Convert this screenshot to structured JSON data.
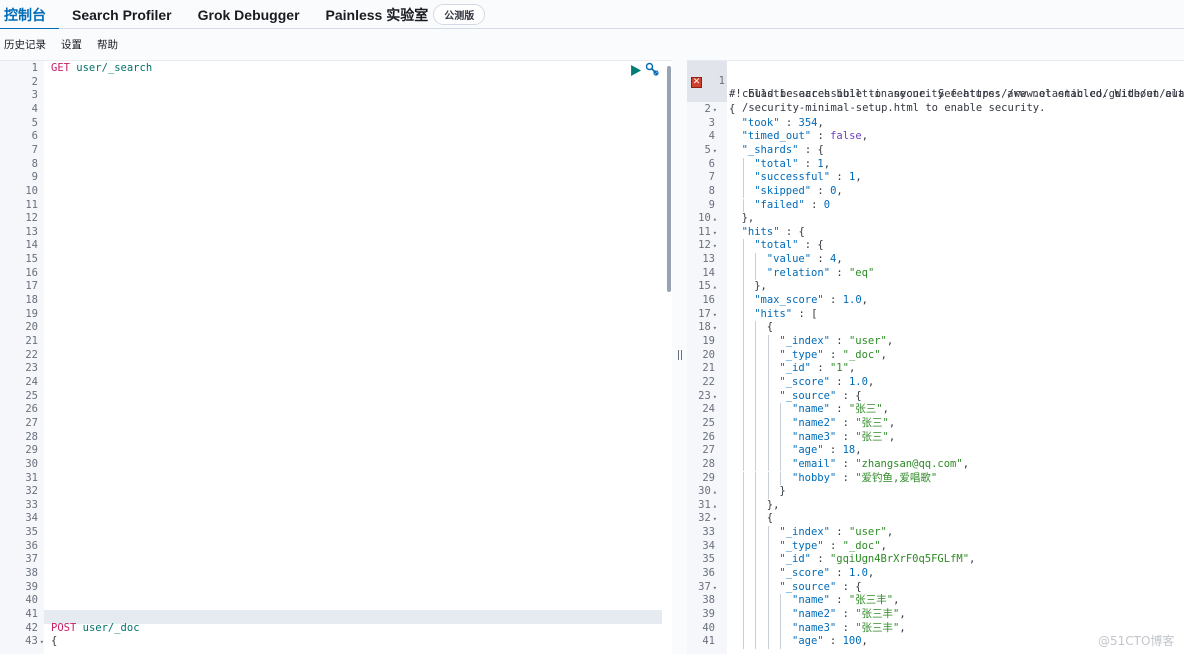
{
  "nav": {
    "tabs": [
      {
        "label": "控制台",
        "active": true
      },
      {
        "label": "Search Profiler",
        "active": false
      },
      {
        "label": "Grok Debugger",
        "active": false
      },
      {
        "label": "Painless 实验室",
        "active": false
      }
    ],
    "beta_badge": "公测版"
  },
  "toolbar": {
    "history": "历史记录",
    "settings": "设置",
    "help": "帮助"
  },
  "request_editor": {
    "line_numbers": [
      "1",
      "2",
      "3",
      "4",
      "5",
      "6",
      "7",
      "8",
      "9",
      "10",
      "11",
      "12",
      "13",
      "14",
      "15",
      "16",
      "17",
      "18",
      "19",
      "20",
      "21",
      "22",
      "23",
      "24",
      "25",
      "26",
      "27",
      "28",
      "29",
      "30",
      "31",
      "32",
      "33",
      "34",
      "35",
      "36",
      "37",
      "38",
      "39",
      "40",
      "41",
      "42",
      "43"
    ],
    "request1": {
      "method": "GET",
      "path": "user/_search"
    },
    "request2": {
      "method": "POST",
      "path": "user/_doc"
    },
    "line43": "{",
    "icons": {
      "run": "play-icon",
      "settings": "wrench-icon"
    }
  },
  "response_editor": {
    "warning": "#! Elasticsearch built-in security features are not enabled. Without auth",
    "warning_cont1": "could be accessible to anyone. See https://www.elastic.co/guide/en/elas",
    "warning_cont2": "/security-minimal-setup.html to enable security.",
    "lines": [
      {
        "n": "2",
        "fold": "▾",
        "indent": 0,
        "parts": [
          [
            "p",
            "{"
          ]
        ]
      },
      {
        "n": "3",
        "indent": 1,
        "parts": [
          [
            "k",
            "\"took\""
          ],
          [
            "p",
            " : "
          ],
          [
            "n",
            "354"
          ],
          [
            "p",
            ","
          ]
        ]
      },
      {
        "n": "4",
        "indent": 1,
        "parts": [
          [
            "k",
            "\"timed_out\""
          ],
          [
            "p",
            " : "
          ],
          [
            "b",
            "false"
          ],
          [
            "p",
            ","
          ]
        ]
      },
      {
        "n": "5",
        "fold": "▾",
        "indent": 1,
        "parts": [
          [
            "k",
            "\"_shards\""
          ],
          [
            "p",
            " : {"
          ]
        ]
      },
      {
        "n": "6",
        "indent": 2,
        "parts": [
          [
            "k",
            "\"total\""
          ],
          [
            "p",
            " : "
          ],
          [
            "n",
            "1"
          ],
          [
            "p",
            ","
          ]
        ]
      },
      {
        "n": "7",
        "indent": 2,
        "parts": [
          [
            "k",
            "\"successful\""
          ],
          [
            "p",
            " : "
          ],
          [
            "n",
            "1"
          ],
          [
            "p",
            ","
          ]
        ]
      },
      {
        "n": "8",
        "indent": 2,
        "parts": [
          [
            "k",
            "\"skipped\""
          ],
          [
            "p",
            " : "
          ],
          [
            "n",
            "0"
          ],
          [
            "p",
            ","
          ]
        ]
      },
      {
        "n": "9",
        "indent": 2,
        "parts": [
          [
            "k",
            "\"failed\""
          ],
          [
            "p",
            " : "
          ],
          [
            "n",
            "0"
          ]
        ]
      },
      {
        "n": "10",
        "fold": "▴",
        "indent": 1,
        "parts": [
          [
            "p",
            "},"
          ]
        ]
      },
      {
        "n": "11",
        "fold": "▾",
        "indent": 1,
        "parts": [
          [
            "k",
            "\"hits\""
          ],
          [
            "p",
            " : {"
          ]
        ]
      },
      {
        "n": "12",
        "fold": "▾",
        "indent": 2,
        "parts": [
          [
            "k",
            "\"total\""
          ],
          [
            "p",
            " : {"
          ]
        ]
      },
      {
        "n": "13",
        "indent": 3,
        "parts": [
          [
            "k",
            "\"value\""
          ],
          [
            "p",
            " : "
          ],
          [
            "n",
            "4"
          ],
          [
            "p",
            ","
          ]
        ]
      },
      {
        "n": "14",
        "indent": 3,
        "parts": [
          [
            "k",
            "\"relation\""
          ],
          [
            "p",
            " : "
          ],
          [
            "s",
            "\"eq\""
          ]
        ]
      },
      {
        "n": "15",
        "fold": "▴",
        "indent": 2,
        "parts": [
          [
            "p",
            "},"
          ]
        ]
      },
      {
        "n": "16",
        "indent": 2,
        "parts": [
          [
            "k",
            "\"max_score\""
          ],
          [
            "p",
            " : "
          ],
          [
            "n",
            "1.0"
          ],
          [
            "p",
            ","
          ]
        ]
      },
      {
        "n": "17",
        "fold": "▾",
        "indent": 2,
        "parts": [
          [
            "k",
            "\"hits\""
          ],
          [
            "p",
            " : ["
          ]
        ]
      },
      {
        "n": "18",
        "fold": "▾",
        "indent": 3,
        "parts": [
          [
            "p",
            "{"
          ]
        ]
      },
      {
        "n": "19",
        "indent": 4,
        "parts": [
          [
            "k",
            "\"_index\""
          ],
          [
            "p",
            " : "
          ],
          [
            "s",
            "\"user\""
          ],
          [
            "p",
            ","
          ]
        ]
      },
      {
        "n": "20",
        "indent": 4,
        "parts": [
          [
            "k",
            "\"_type\""
          ],
          [
            "p",
            " : "
          ],
          [
            "s",
            "\"_doc\""
          ],
          [
            "p",
            ","
          ]
        ]
      },
      {
        "n": "21",
        "indent": 4,
        "parts": [
          [
            "k",
            "\"_id\""
          ],
          [
            "p",
            " : "
          ],
          [
            "s",
            "\"1\""
          ],
          [
            "p",
            ","
          ]
        ]
      },
      {
        "n": "22",
        "indent": 4,
        "parts": [
          [
            "k",
            "\"_score\""
          ],
          [
            "p",
            " : "
          ],
          [
            "n",
            "1.0"
          ],
          [
            "p",
            ","
          ]
        ]
      },
      {
        "n": "23",
        "fold": "▾",
        "indent": 4,
        "parts": [
          [
            "k",
            "\"_source\""
          ],
          [
            "p",
            " : {"
          ]
        ]
      },
      {
        "n": "24",
        "indent": 5,
        "parts": [
          [
            "k",
            "\"name\""
          ],
          [
            "p",
            " : "
          ],
          [
            "s",
            "\"张三\""
          ],
          [
            "p",
            ","
          ]
        ]
      },
      {
        "n": "25",
        "indent": 5,
        "parts": [
          [
            "k",
            "\"name2\""
          ],
          [
            "p",
            " : "
          ],
          [
            "s",
            "\"张三\""
          ],
          [
            "p",
            ","
          ]
        ]
      },
      {
        "n": "26",
        "indent": 5,
        "parts": [
          [
            "k",
            "\"name3\""
          ],
          [
            "p",
            " : "
          ],
          [
            "s",
            "\"张三\""
          ],
          [
            "p",
            ","
          ]
        ]
      },
      {
        "n": "27",
        "indent": 5,
        "parts": [
          [
            "k",
            "\"age\""
          ],
          [
            "p",
            " : "
          ],
          [
            "n",
            "18"
          ],
          [
            "p",
            ","
          ]
        ]
      },
      {
        "n": "28",
        "indent": 5,
        "parts": [
          [
            "k",
            "\"email\""
          ],
          [
            "p",
            " : "
          ],
          [
            "s",
            "\"zhangsan@qq.com\""
          ],
          [
            "p",
            ","
          ]
        ]
      },
      {
        "n": "29",
        "indent": 5,
        "parts": [
          [
            "k",
            "\"hobby\""
          ],
          [
            "p",
            " : "
          ],
          [
            "s",
            "\"爱钓鱼,爱唱歌\""
          ]
        ]
      },
      {
        "n": "30",
        "fold": "▴",
        "indent": 4,
        "parts": [
          [
            "p",
            "}"
          ]
        ]
      },
      {
        "n": "31",
        "fold": "▴",
        "indent": 3,
        "parts": [
          [
            "p",
            "},"
          ]
        ]
      },
      {
        "n": "32",
        "fold": "▾",
        "indent": 3,
        "parts": [
          [
            "p",
            "{"
          ]
        ]
      },
      {
        "n": "33",
        "indent": 4,
        "parts": [
          [
            "k",
            "\"_index\""
          ],
          [
            "p",
            " : "
          ],
          [
            "s",
            "\"user\""
          ],
          [
            "p",
            ","
          ]
        ]
      },
      {
        "n": "34",
        "indent": 4,
        "parts": [
          [
            "k",
            "\"_type\""
          ],
          [
            "p",
            " : "
          ],
          [
            "s",
            "\"_doc\""
          ],
          [
            "p",
            ","
          ]
        ]
      },
      {
        "n": "35",
        "indent": 4,
        "parts": [
          [
            "k",
            "\"_id\""
          ],
          [
            "p",
            " : "
          ],
          [
            "s",
            "\"gqiUgn4BrXrF0q5FGLfM\""
          ],
          [
            "p",
            ","
          ]
        ]
      },
      {
        "n": "36",
        "indent": 4,
        "parts": [
          [
            "k",
            "\"_score\""
          ],
          [
            "p",
            " : "
          ],
          [
            "n",
            "1.0"
          ],
          [
            "p",
            ","
          ]
        ]
      },
      {
        "n": "37",
        "fold": "▾",
        "indent": 4,
        "parts": [
          [
            "k",
            "\"_source\""
          ],
          [
            "p",
            " : {"
          ]
        ]
      },
      {
        "n": "38",
        "indent": 5,
        "parts": [
          [
            "k",
            "\"name\""
          ],
          [
            "p",
            " : "
          ],
          [
            "s",
            "\"张三丰\""
          ],
          [
            "p",
            ","
          ]
        ]
      },
      {
        "n": "39",
        "indent": 5,
        "parts": [
          [
            "k",
            "\"name2\""
          ],
          [
            "p",
            " : "
          ],
          [
            "s",
            "\"张三丰\""
          ],
          [
            "p",
            ","
          ]
        ]
      },
      {
        "n": "40",
        "indent": 5,
        "parts": [
          [
            "k",
            "\"name3\""
          ],
          [
            "p",
            " : "
          ],
          [
            "s",
            "\"张三丰\""
          ],
          [
            "p",
            ","
          ]
        ]
      },
      {
        "n": "41",
        "indent": 5,
        "parts": [
          [
            "k",
            "\"age\""
          ],
          [
            "p",
            " : "
          ],
          [
            "n",
            "100"
          ],
          [
            "p",
            ","
          ]
        ]
      }
    ]
  },
  "watermark": "@51CTO博客"
}
